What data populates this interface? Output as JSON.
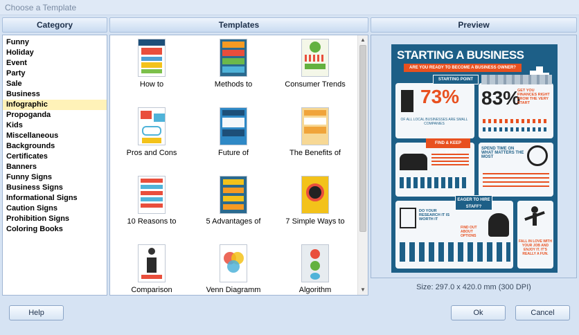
{
  "window": {
    "title": "Choose a Template"
  },
  "headers": {
    "category": "Category",
    "templates": "Templates",
    "preview": "Preview"
  },
  "categories": [
    "Funny",
    "Holiday",
    "Event",
    "Party",
    "Sale",
    "Business",
    "Infographic",
    "Propoganda",
    "Kids",
    "Miscellaneous",
    "Backgrounds",
    "Certificates",
    "Banners",
    "Funny Signs",
    "Business Signs",
    "Informational Signs",
    "Caution Signs",
    "Prohibition Signs",
    "Coloring Books"
  ],
  "selected_category": "Infographic",
  "templates": [
    {
      "label": "How to"
    },
    {
      "label": "Methods to"
    },
    {
      "label": "Consumer Trends"
    },
    {
      "label": "Pros and Cons"
    },
    {
      "label": "Future of"
    },
    {
      "label": "The Benefits of"
    },
    {
      "label": "10 Reasons to"
    },
    {
      "label": "5 Advantages of"
    },
    {
      "label": "7 Simple Ways to"
    },
    {
      "label": "Comparison"
    },
    {
      "label": "Venn Diagramm"
    },
    {
      "label": "Algorithm"
    }
  ],
  "preview": {
    "title": "STARTING A BUSINESS",
    "subtitle": "ARE YOU READY TO BECOME A BUSINESS OWNER?",
    "starting_point": "STARTING POINT",
    "pct1": "73%",
    "pct1_caption": "OF ALL LOCAL BUSINESSES ARE SMALL COMPANIES",
    "pct2": "83%",
    "finances": "GET YOU FINANCES RIGHT FROM THE VERY START",
    "find_clients": "FIND & KEEP CLIENTS",
    "spend_time": "SPEND TIME ON WHAT MATTERS THE MOST",
    "hire": "EAGER TO HIRE STAFF?",
    "research": "DO YOUR RESEARCH IT IS WORTH IT",
    "options": "FIND OUT ABOUT OPTIONS",
    "love": "FALL IN LOVE WITH YOUR JOB AND ENJOY IT. IT'S REALLY A FUN.",
    "size": "Size: 297.0 x 420.0 mm (300 DPI)"
  },
  "buttons": {
    "help": "Help",
    "ok": "Ok",
    "cancel": "Cancel"
  },
  "colors": {
    "selection": "#fff2b8",
    "poster_bg": "#1d5f87",
    "accent_orange": "#e8501f"
  }
}
